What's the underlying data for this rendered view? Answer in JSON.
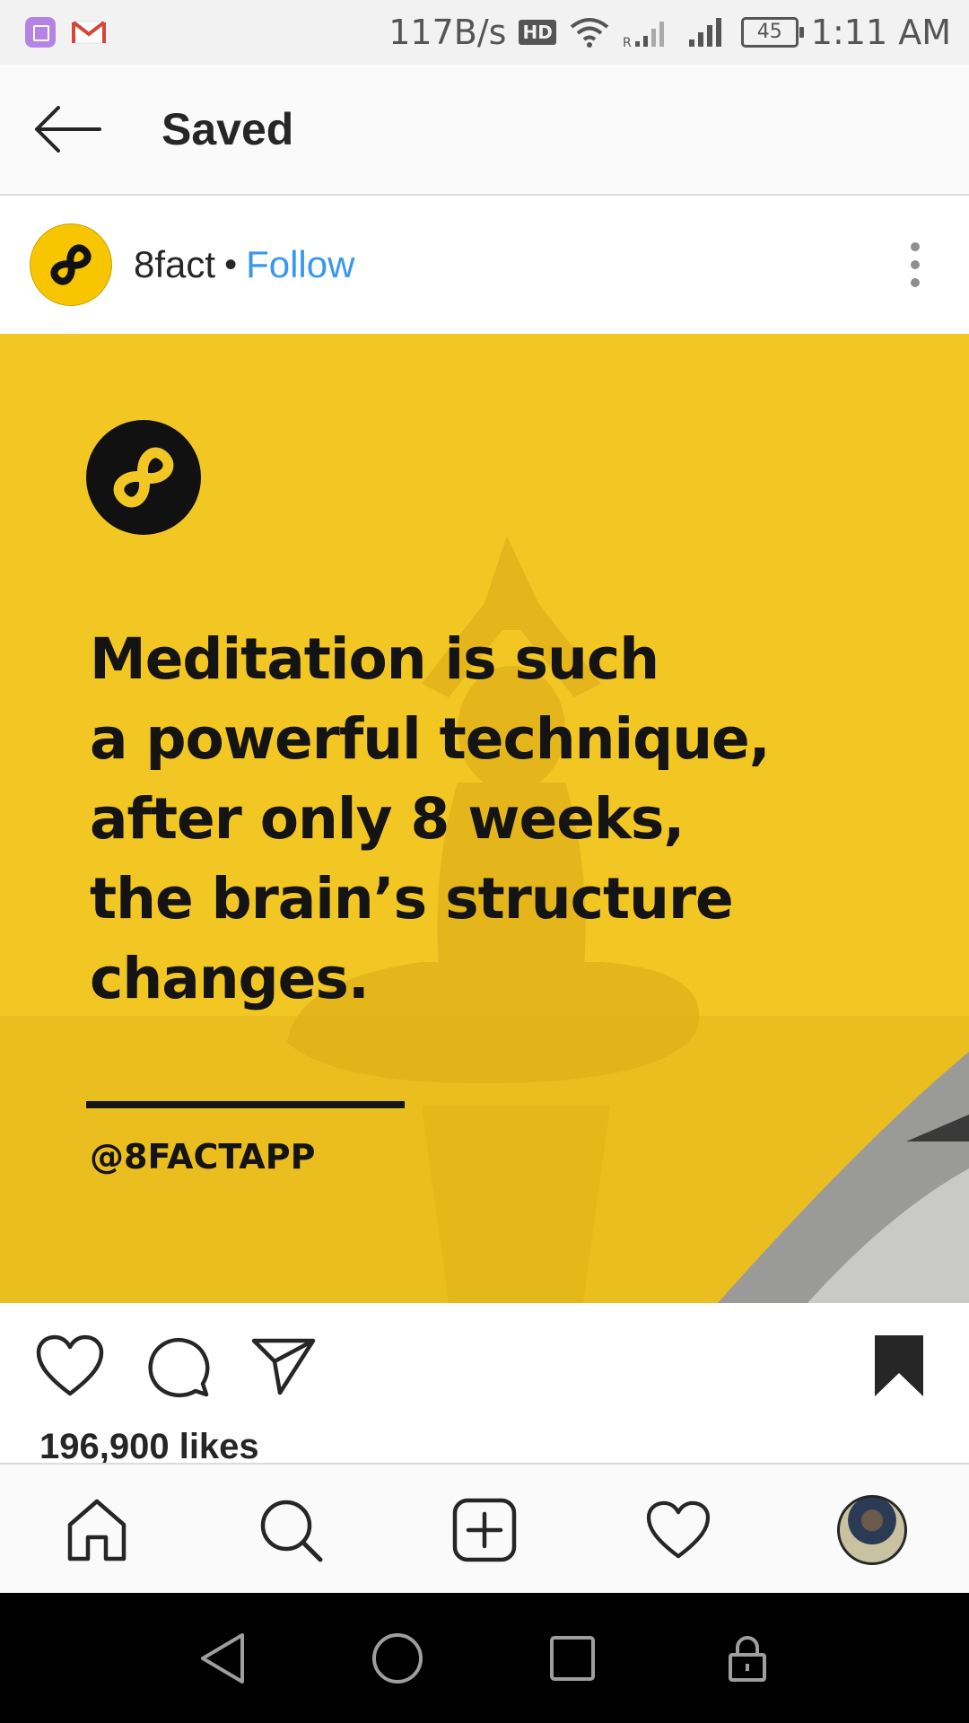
{
  "status_bar": {
    "network_speed": "117B/s",
    "hd_label": "HD",
    "battery_level": "45",
    "time": "1:11 AM",
    "icons": [
      "gallery-app-icon",
      "gmail-icon",
      "wifi-icon",
      "signal-icon",
      "battery-icon"
    ]
  },
  "header": {
    "title": "Saved",
    "back_icon": "arrow-left-icon"
  },
  "post": {
    "username": "8fact",
    "separator": "•",
    "follow_label": "Follow",
    "more_icon": "more-vertical-icon",
    "image": {
      "quote_lines": [
        "Meditation is such",
        "a powerful technique,",
        "after only 8 weeks,",
        "the brain’s structure",
        "changes."
      ],
      "handle": "@8FACTAPP",
      "background_color": "#f2c623"
    },
    "likes": "196,900 likes",
    "saved": true
  },
  "bottom_nav": {
    "items": [
      "home-icon",
      "search-icon",
      "new-post-icon",
      "activity-heart-icon",
      "profile-avatar"
    ]
  },
  "system_nav": {
    "items": [
      "back-triangle-icon",
      "home-circle-icon",
      "recents-square-icon",
      "lock-icon"
    ]
  },
  "colors": {
    "link": "#3897f0",
    "brand_yellow": "#f2c623",
    "text": "#262626"
  }
}
